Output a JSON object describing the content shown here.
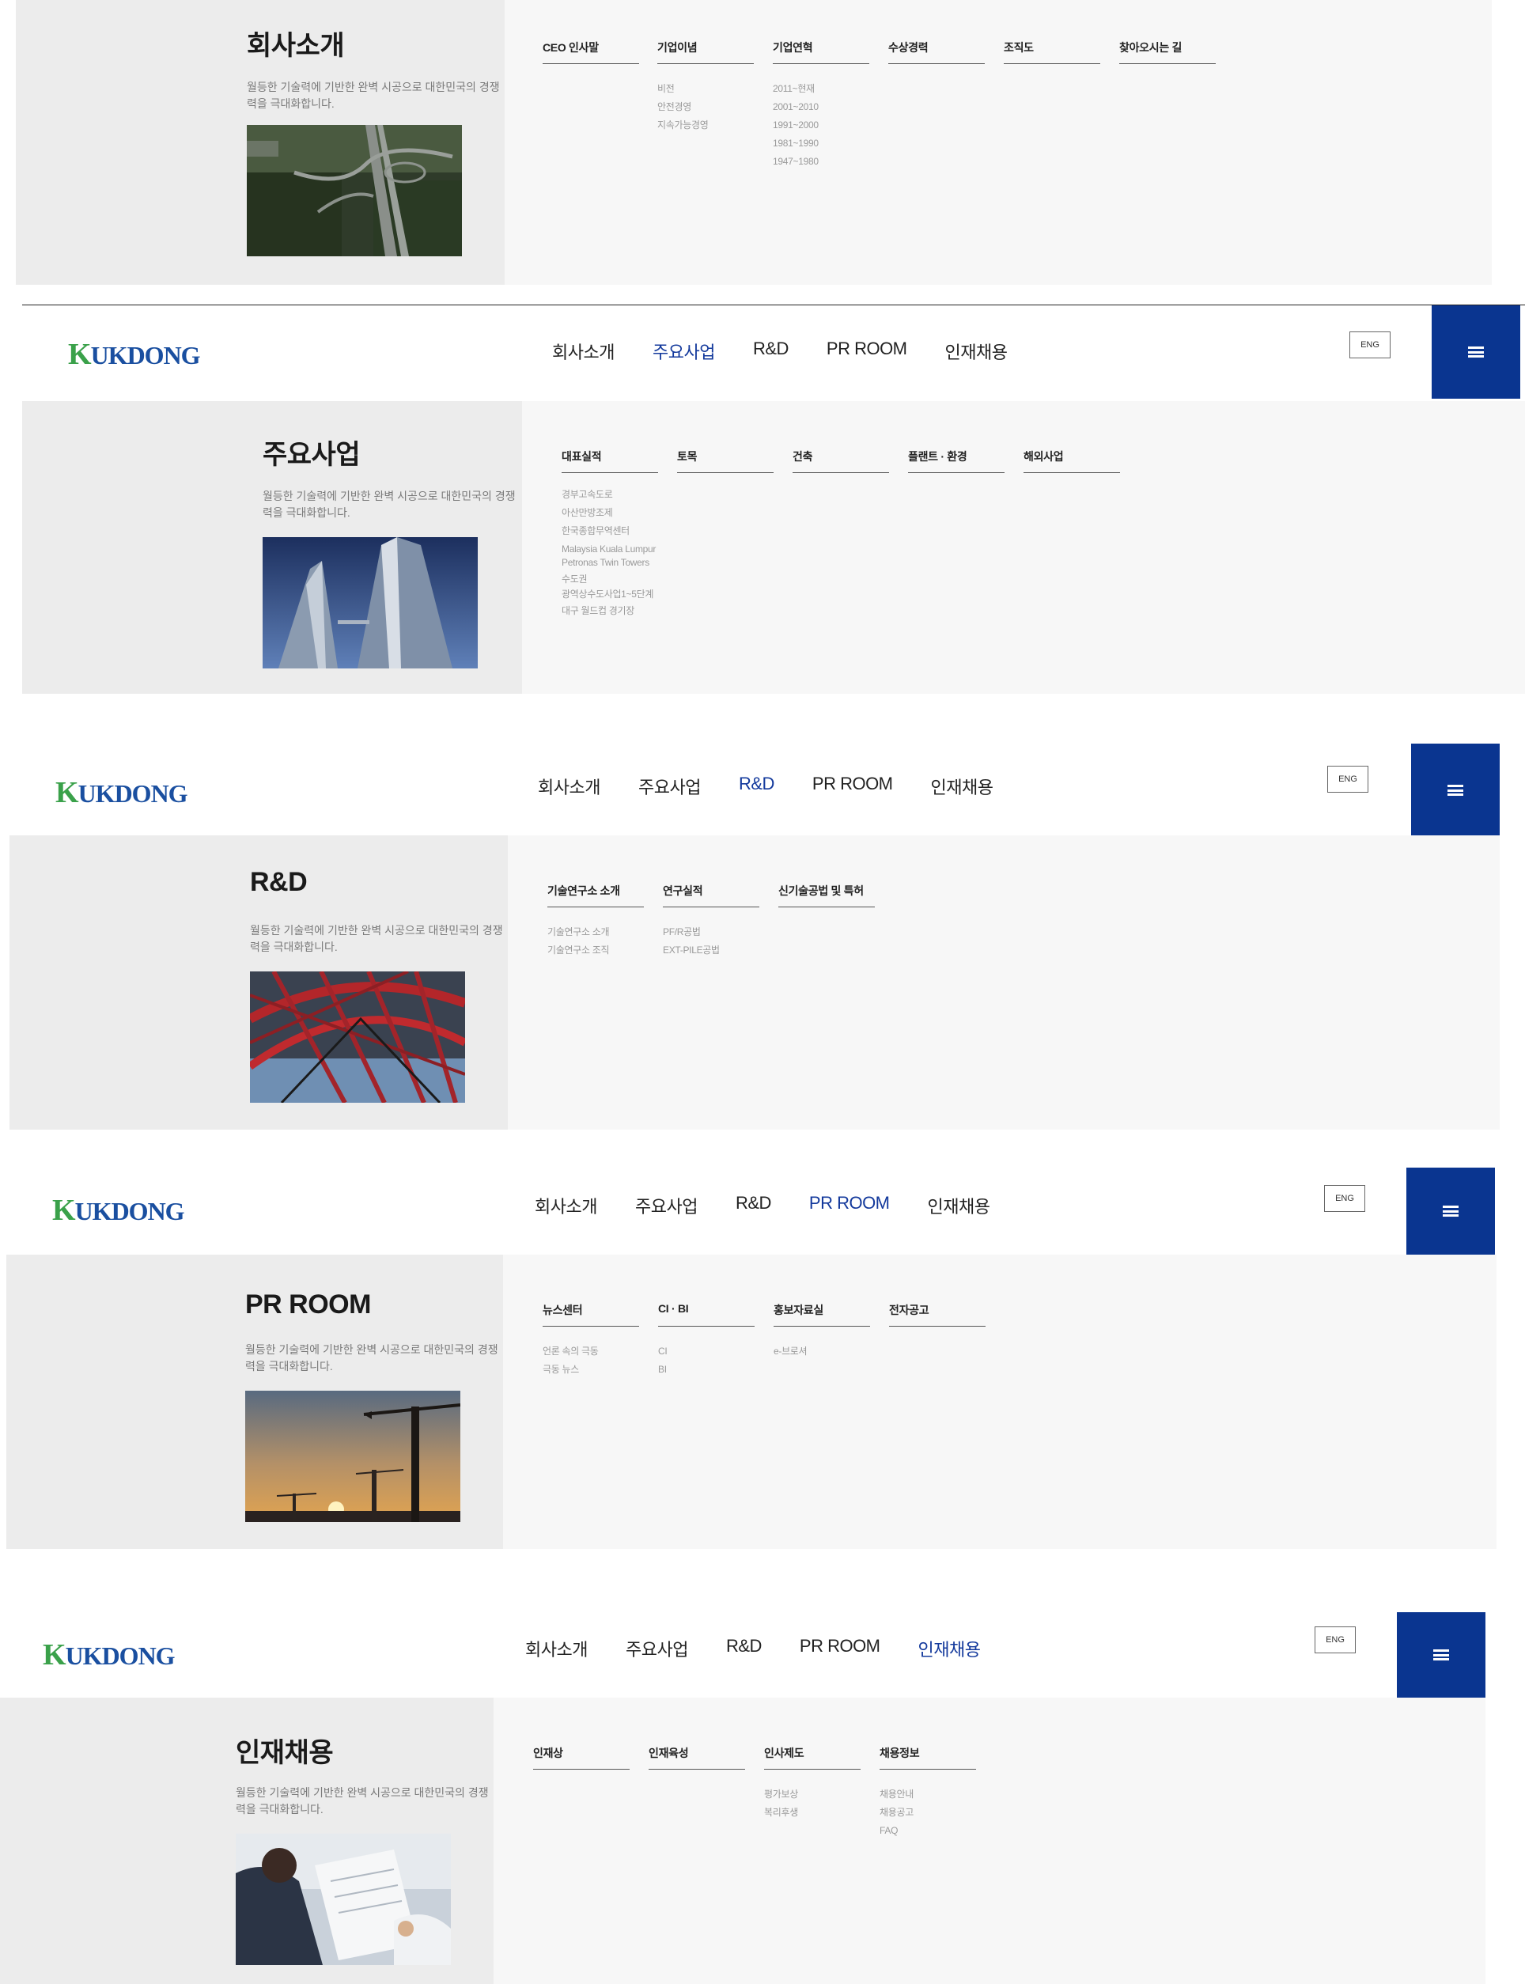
{
  "brand": {
    "logo_first": "K",
    "logo_rest": "UKDONG"
  },
  "header": {
    "nav": [
      "회사소개",
      "주요사업",
      "R&D",
      "PR ROOM",
      "인재채용"
    ],
    "eng_label": "ENG"
  },
  "panels": [
    {
      "active_nav": "",
      "title": "회사소개",
      "desc": "월등한 기술력에 기반한 완벽 시공으로 대한민국의 경쟁력을 극대화합니다.",
      "image": "highway-aerial-image",
      "columns": [
        {
          "label": "CEO 인사말",
          "items": []
        },
        {
          "label": "기업이념",
          "items": [
            "비전",
            "안전경영",
            "지속가능경영"
          ]
        },
        {
          "label": "기업연혁",
          "items": [
            "2011~현재",
            "2001~2010",
            "1991~2000",
            "1981~1990",
            "1947~1980"
          ]
        },
        {
          "label": "수상경력",
          "items": []
        },
        {
          "label": "조직도",
          "items": []
        },
        {
          "label": "찾아오시는 길",
          "items": []
        }
      ]
    },
    {
      "active_nav": "주요사업",
      "title": "주요사업",
      "desc": "월등한 기술력에 기반한 완벽 시공으로 대한민국의 경쟁력을 극대화합니다.",
      "image": "twin-towers-image",
      "columns": [
        {
          "label": "대표실적",
          "items": [
            "경부고속도로",
            "아산만방조제",
            "한국종합무역센터",
            "Malaysia Kuala Lumpur",
            "Petronas Twin Towers",
            "수도권",
            "광역상수도사업1~5단계",
            "대구 월드컵 경기장"
          ]
        },
        {
          "label": "토목",
          "items": []
        },
        {
          "label": "건축",
          "items": []
        },
        {
          "label": "플랜트 · 환경",
          "items": []
        },
        {
          "label": "해외사업",
          "items": []
        }
      ]
    },
    {
      "active_nav": "R&D",
      "title": "R&D",
      "desc": "월등한 기술력에 기반한 완벽 시공으로 대한민국의 경쟁력을 극대화합니다.",
      "image": "red-steel-structure-image",
      "columns": [
        {
          "label": "기술연구소 소개",
          "items": [
            "기술연구소 소개",
            "기술연구소 조직"
          ]
        },
        {
          "label": "연구실적",
          "items": [
            "PF/R공법",
            "EXT-PILE공법"
          ]
        },
        {
          "label": "신기술공법 및 특허",
          "items": []
        }
      ]
    },
    {
      "active_nav": "PR ROOM",
      "title": "PR ROOM",
      "desc": "월등한 기술력에 기반한 완벽 시공으로 대한민국의 경쟁력을 극대화합니다.",
      "image": "crane-sunset-image",
      "columns": [
        {
          "label": "뉴스센터",
          "items": [
            "언론 속의 극동",
            "극동 뉴스"
          ]
        },
        {
          "label": "CI · BI",
          "items": [
            "CI",
            "BI"
          ]
        },
        {
          "label": "홍보자료실",
          "items": [
            "e-브로셔"
          ]
        },
        {
          "label": "전자공고",
          "items": []
        }
      ]
    },
    {
      "active_nav": "인재채용",
      "title": "인재채용",
      "desc": "월등한 기술력에 기반한 완벽 시공으로 대한민국의 경쟁력을 극대화합니다.",
      "image": "business-meeting-image",
      "columns": [
        {
          "label": "인재상",
          "items": []
        },
        {
          "label": "인재육성",
          "items": []
        },
        {
          "label": "인사제도",
          "items": [
            "평가보상",
            "복리후생"
          ]
        },
        {
          "label": "채용정보",
          "items": [
            "채용안내",
            "채용공고",
            "FAQ"
          ]
        }
      ]
    }
  ]
}
